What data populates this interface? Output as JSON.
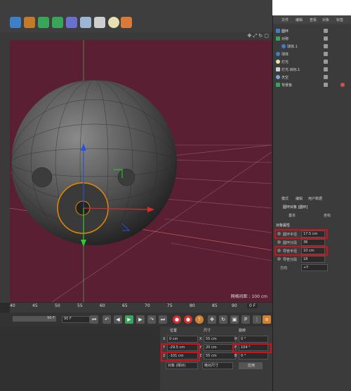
{
  "object_manager": {
    "menu": [
      "文件",
      "编辑",
      "查看",
      "对象",
      "标签"
    ],
    "objects": [
      {
        "name": "圆环",
        "type": "torus"
      },
      {
        "name": "对称",
        "type": "symmetry"
      },
      {
        "name": "球体.1",
        "type": "sphere"
      },
      {
        "name": "球体",
        "type": "sphere"
      },
      {
        "name": "灯光",
        "type": "light"
      },
      {
        "name": "灯光.目标.1",
        "type": "target"
      },
      {
        "name": "天空",
        "type": "sky"
      },
      {
        "name": "背景板",
        "type": "background"
      }
    ]
  },
  "attribute_manager": {
    "menu": [
      "模式",
      "编辑",
      "用户数据"
    ],
    "object_title": "圆环对象 [圆环]",
    "tabs": [
      "基本",
      "坐标"
    ],
    "section": "对象属性",
    "fields": [
      {
        "label": "圆环半径",
        "value": "17.5 cm"
      },
      {
        "label": "圆环分段",
        "value": "36"
      },
      {
        "label": "导管半径",
        "value": "10 cm"
      },
      {
        "label": "导管分段",
        "value": "18"
      }
    ],
    "direction_label": "方向",
    "direction_value": "+Y"
  },
  "viewport": {
    "grid_spacing": "网格间距 : 100 cm"
  },
  "timeline": {
    "ticks": [
      "40",
      "45",
      "50",
      "55",
      "60",
      "65",
      "70",
      "75",
      "80",
      "85",
      "90"
    ],
    "current_frame": "0 F",
    "end_frame_a": "90 F",
    "end_frame_b": "90 F"
  },
  "coordinates": {
    "headers": [
      "位置",
      "尺寸",
      "旋转"
    ],
    "rows": [
      {
        "axis": "X",
        "pos": "0 cm",
        "size_axis": "X",
        "size": "55 cm",
        "rot_axis": "H",
        "rot": "0 °"
      },
      {
        "axis": "Y",
        "pos": "-29.5 cm",
        "size_axis": "Y",
        "size": "20 cm",
        "rot_axis": "P",
        "rot": "104 °"
      },
      {
        "axis": "Z",
        "pos": "-101 cm",
        "size_axis": "Z",
        "size": "55 cm",
        "rot_axis": "B",
        "rot": "0 °"
      }
    ],
    "mode_select": "对象 (相对)",
    "size_select": "绝对尺寸",
    "apply_label": "应用"
  },
  "colors": {
    "viewport_bg": "#5a1f33",
    "highlight": "#d0101a",
    "torus_selected": "#e08a00"
  }
}
